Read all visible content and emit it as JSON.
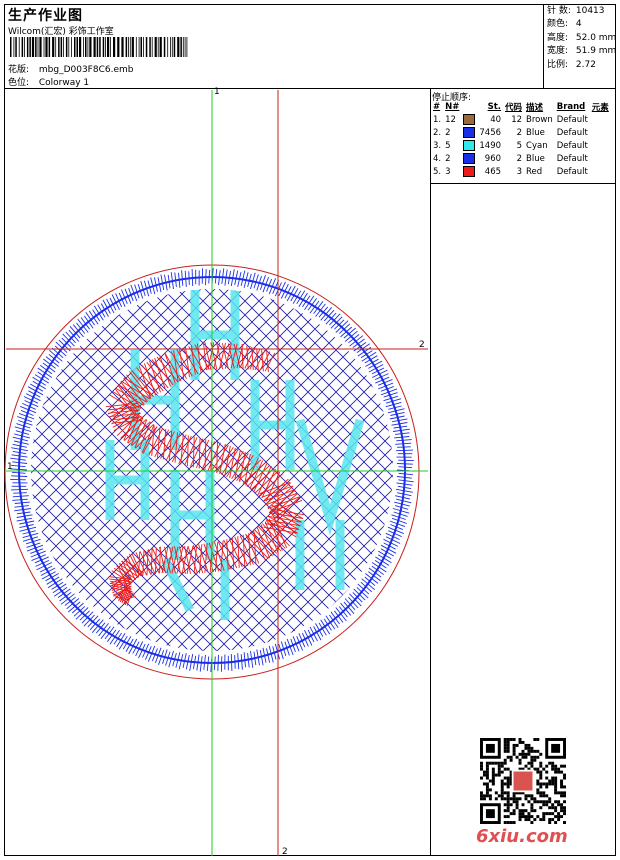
{
  "header": {
    "title": "生产作业图",
    "company": "Wilcom(汇宏) 彩饰工作室",
    "design_label": "花版:",
    "design_value": "mbg_D003F8C6.emb",
    "colorway_label": "色位:",
    "colorway_value": "Colorway 1"
  },
  "stats": {
    "stitches_label": "针 数:",
    "stitches": "10413",
    "colors_label": "颜色:",
    "colors": "4",
    "height_label": "高度:",
    "height": "52.0 mm",
    "width_label": "宽度:",
    "width": "51.9 mm",
    "ratio_label": "比例:",
    "ratio": "2.72"
  },
  "sequence": {
    "title": "停止顺序:",
    "headers": [
      "#",
      "N#",
      "St.",
      "代码",
      "描述",
      "Brand",
      "元素"
    ],
    "rows": [
      {
        "idx": "1.",
        "n": "12",
        "color": "#9a6a3c",
        "st": "40",
        "code": "12",
        "desc": "Brown",
        "brand": "Default"
      },
      {
        "idx": "2.",
        "n": "2",
        "color": "#1a2ee8",
        "st": "7456",
        "code": "2",
        "desc": "Blue",
        "brand": "Default"
      },
      {
        "idx": "3.",
        "n": "5",
        "color": "#2ee8ec",
        "st": "1490",
        "code": "5",
        "desc": "Cyan",
        "brand": "Default"
      },
      {
        "idx": "4.",
        "n": "2",
        "color": "#1a2ee8",
        "st": "960",
        "code": "2",
        "desc": "Blue",
        "brand": "Default"
      },
      {
        "idx": "5.",
        "n": "3",
        "color": "#ee1b1b",
        "st": "465",
        "code": "3",
        "desc": "Red",
        "brand": "Default"
      }
    ]
  },
  "markers": {
    "top": "1",
    "right": "2",
    "bottom": "2",
    "left": "1"
  },
  "watermark": "6xiu.com"
}
